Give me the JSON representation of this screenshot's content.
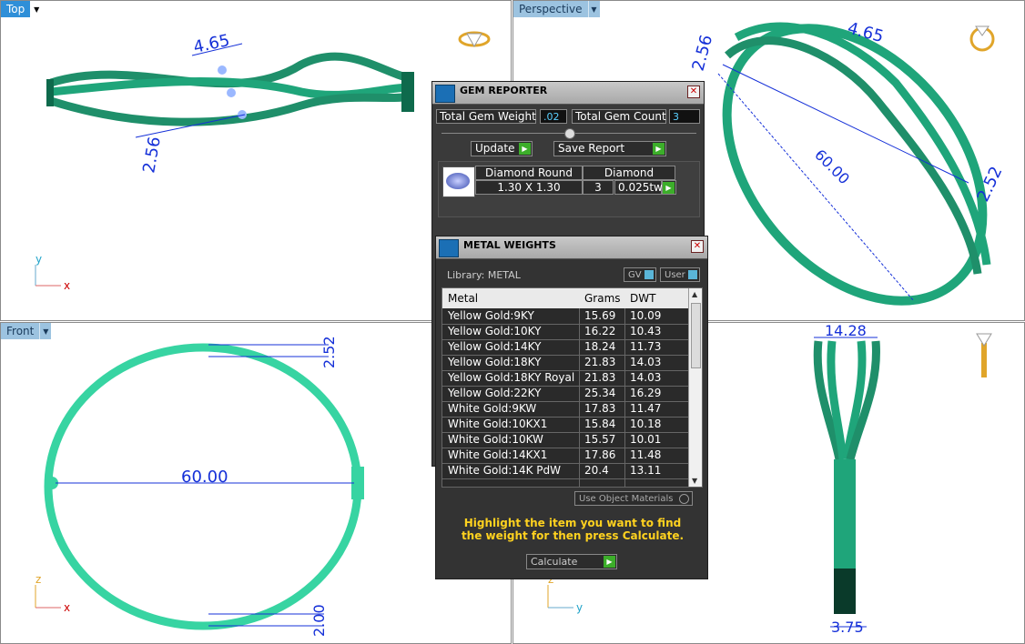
{
  "viewports": {
    "top": {
      "label": "Top",
      "dims": {
        "d1": "4.65",
        "d2": "2.56"
      },
      "axes": {
        "a1": "y",
        "a2": "x"
      }
    },
    "perspective": {
      "label": "Perspective",
      "dims": {
        "d1": "4.65",
        "d2": "2.56",
        "d3": "60.00",
        "d4": "2.52"
      }
    },
    "front": {
      "label": "Front",
      "dims": {
        "d1": "2.52",
        "d2": "60.00",
        "d3": "2.00"
      },
      "axes": {
        "a1": "z",
        "a2": "x"
      }
    },
    "right": {
      "dims": {
        "d1": "14.28",
        "d2": "3.75"
      },
      "axes": {
        "a1": "z",
        "a2": "y"
      }
    }
  },
  "gem_reporter": {
    "title": "GEM REPORTER",
    "total_weight_label": "Total Gem Weight",
    "total_weight_value": ".02",
    "total_count_label": "Total Gem Count",
    "total_count_value": "3",
    "update_label": "Update",
    "save_label": "Save Report",
    "gem": {
      "name": "Diamond Round",
      "type": "Diamond",
      "size": "1.30 X 1.30",
      "qty": "3",
      "weight": "0.025tw"
    }
  },
  "metal_weights": {
    "title": "METAL WEIGHTS",
    "library_label": "Library: METAL",
    "gv_label": "GV",
    "user_label": "User",
    "columns": {
      "metal": "Metal",
      "grams": "Grams",
      "dwt": "DWT"
    },
    "rows": [
      {
        "metal": "Yellow Gold:9KY",
        "grams": "15.69",
        "dwt": "10.09"
      },
      {
        "metal": "Yellow Gold:10KY",
        "grams": "16.22",
        "dwt": "10.43"
      },
      {
        "metal": "Yellow Gold:14KY",
        "grams": "18.24",
        "dwt": "11.73"
      },
      {
        "metal": "Yellow Gold:18KY",
        "grams": "21.83",
        "dwt": "14.03"
      },
      {
        "metal": "Yellow Gold:18KY Royal",
        "grams": "21.83",
        "dwt": "14.03"
      },
      {
        "metal": "Yellow Gold:22KY",
        "grams": "25.34",
        "dwt": "16.29"
      },
      {
        "metal": "White Gold:9KW",
        "grams": "17.83",
        "dwt": "11.47"
      },
      {
        "metal": "White Gold:10KX1",
        "grams": "15.84",
        "dwt": "10.18"
      },
      {
        "metal": "White Gold:10KW",
        "grams": "15.57",
        "dwt": "10.01"
      },
      {
        "metal": "White Gold:14KX1",
        "grams": "17.86",
        "dwt": "11.48"
      },
      {
        "metal": "White Gold:14K PdW",
        "grams": "20.4",
        "dwt": "13.11"
      }
    ],
    "use_object_materials": "Use Object Materials",
    "instruction": "Highlight the item you want to find the weight for then press Calculate.",
    "calculate_label": "Calculate"
  },
  "colors": {
    "ring_green": "#1fa57a",
    "ring_light": "#3fdcab",
    "dimension_blue": "#1530d8",
    "accent_yellow": "#ffd21f"
  }
}
